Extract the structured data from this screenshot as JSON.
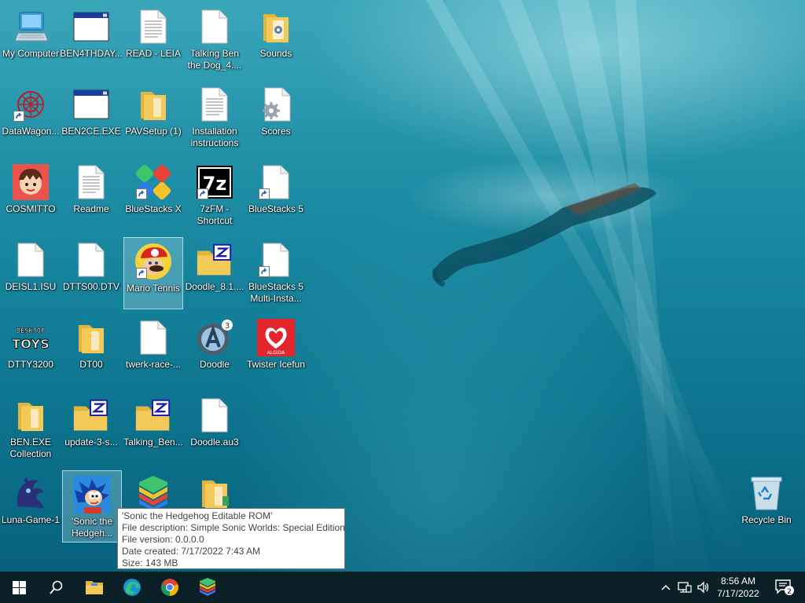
{
  "desktop": {
    "icons": [
      {
        "label": "My Computer"
      },
      {
        "label": "BEN4THDAY..."
      },
      {
        "label": "READ - LEIA"
      },
      {
        "label": "Talking Ben the Dog_4...."
      },
      {
        "label": "Sounds"
      },
      {
        "label": "DataWagon..."
      },
      {
        "label": "BEN2CE.EXE"
      },
      {
        "label": "PAVSetup (1)"
      },
      {
        "label": "Installation instructions"
      },
      {
        "label": "Scores"
      },
      {
        "label": "COSMITTO"
      },
      {
        "label": "Readme"
      },
      {
        "label": "BlueStacks X"
      },
      {
        "label": "7zFM - Shortcut"
      },
      {
        "label": "BlueStacks 5"
      },
      {
        "label": "DEISL1.ISU"
      },
      {
        "label": "DTTS00.DTV"
      },
      {
        "label": "Mario Tennis"
      },
      {
        "label": "Doodle_8.1...."
      },
      {
        "label": "BlueStacks 5 Multi-Insta..."
      },
      {
        "label": "DTTY3200"
      },
      {
        "label": "DT00"
      },
      {
        "label": "twerk-race-..."
      },
      {
        "label": "Doodle"
      },
      {
        "label": "Twister Icefun"
      },
      {
        "label": "BEN.EXE Collection"
      },
      {
        "label": "update-3-s..."
      },
      {
        "label": "Talking_Ben..."
      },
      {
        "label": "Doodle.au3"
      },
      {
        "label": "Luna-Game-1"
      },
      {
        "label": "'Sonic the Hedgeh..."
      },
      {
        "label": ""
      },
      {
        "label": ""
      },
      {
        "label": "Recycle Bin"
      }
    ],
    "icon_text": {
      "seven_z": "7z",
      "desktop_toys_line1": "DESKTOP",
      "desktop_toys_line2": "TOYS",
      "algida": "ALGIDA",
      "doodle_three": "3"
    }
  },
  "tooltip": {
    "name": "'Sonic the Hedgehog Editable ROM'",
    "description": "File description: Simple Sonic Worlds: Special Edition",
    "version": "File version: 0.0.0.0",
    "created": "Date created: 7/17/2022 7:43 AM",
    "size": "Size: 143 MB"
  },
  "taskbar": {
    "pinned": [
      "start-button",
      "search-button",
      "file-explorer",
      "edge",
      "chrome",
      "bluestacks"
    ],
    "tray": {
      "time": "8:56 AM",
      "date": "7/17/2022",
      "notification_count": "2"
    }
  },
  "colors": {
    "taskbar": "#0b1f27",
    "water_top": "#3aa6ba",
    "water_bottom": "#07627c",
    "folder": "#f3c957",
    "windows_blue": "#0078d7"
  }
}
